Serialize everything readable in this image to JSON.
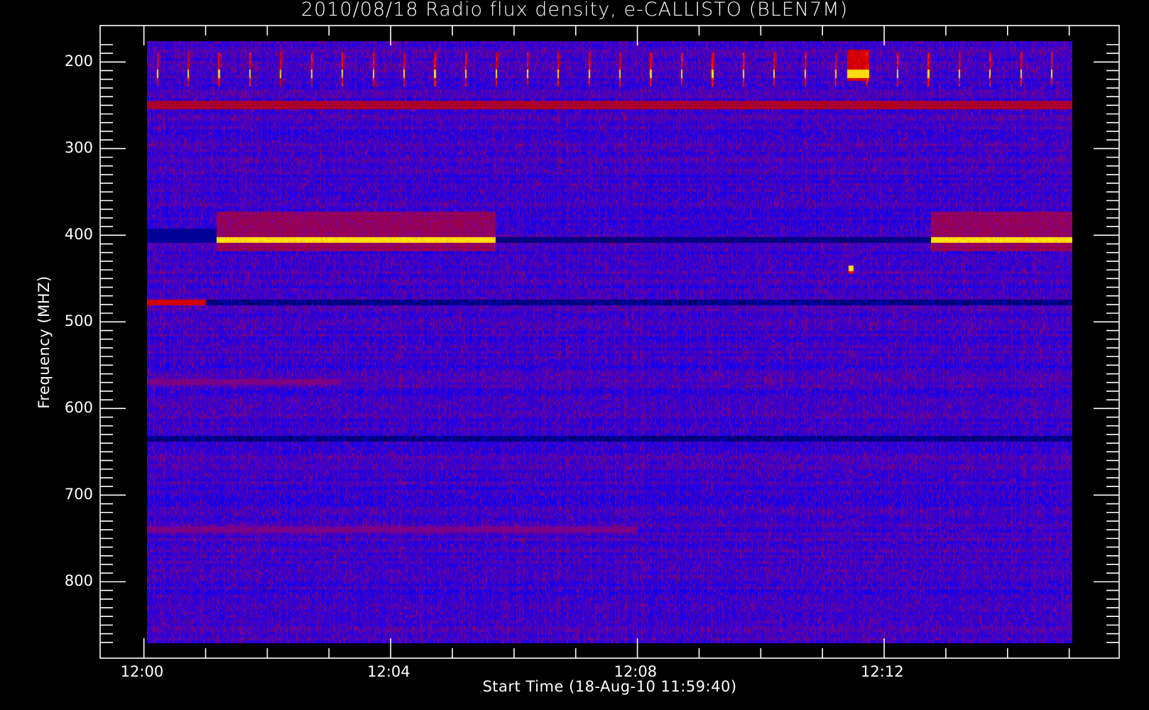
{
  "chart_data": {
    "type": "heatmap",
    "title": "2010/08/18  Radio flux density, e-CALLISTO (BLEN7M)",
    "xlabel": "Start Time (18-Aug-10 11:59:40)",
    "ylabel": "Frequency (MHZ)",
    "x_unit": "minutes after 12:00",
    "xlim": [
      0.05,
      15.05
    ],
    "ylim": [
      871,
      176
    ],
    "xticks": [
      {
        "value": 0,
        "label": "12:00"
      },
      {
        "value": 4,
        "label": "12:04"
      },
      {
        "value": 8,
        "label": "12:08"
      },
      {
        "value": 12,
        "label": "12:12"
      }
    ],
    "x_minor_step": 1,
    "yticks": [
      {
        "value": 200,
        "label": "200"
      },
      {
        "value": 300,
        "label": "300"
      },
      {
        "value": 400,
        "label": "400"
      },
      {
        "value": 500,
        "label": "500"
      },
      {
        "value": 600,
        "label": "600"
      },
      {
        "value": 700,
        "label": "700"
      },
      {
        "value": 800,
        "label": "800"
      }
    ],
    "y_minor_step": 10,
    "colormap": [
      "#000000",
      "#0000ff",
      "#7a0090",
      "#c00000",
      "#ff0000",
      "#ff8040",
      "#ffff00"
    ],
    "features": [
      {
        "name": "periodic bursts",
        "freq_range": [
          190,
          228
        ],
        "peak_freq": 213,
        "period_min": 0.5,
        "t_range": [
          0.2,
          15
        ]
      },
      {
        "name": "strong burst",
        "freq_range": [
          185,
          222
        ],
        "t_range": [
          11.4,
          11.75
        ]
      },
      {
        "name": "interference band",
        "freq": 250,
        "t_range": [
          0.05,
          15.05
        ]
      },
      {
        "name": "carrier line bright",
        "freq": 405,
        "t_range": [
          1.17,
          5.7
        ]
      },
      {
        "name": "carrier line dark",
        "freq": 405,
        "t_range": [
          5.7,
          12.75
        ]
      },
      {
        "name": "carrier line bright",
        "freq": 405,
        "t_range": [
          12.75,
          15.05
        ]
      },
      {
        "name": "spot",
        "freq": 440,
        "t_range": [
          11.42,
          11.5
        ]
      },
      {
        "name": "dark line",
        "freq": 478,
        "t_range": [
          0.05,
          15.05
        ]
      },
      {
        "name": "weak band",
        "freq": 570,
        "t_range": [
          0.05,
          3.2
        ]
      },
      {
        "name": "dark line",
        "freq": 635,
        "t_range": [
          0.05,
          15.05
        ]
      },
      {
        "name": "weak band",
        "freq": 740,
        "t_range": [
          0.05,
          8
        ]
      }
    ],
    "colors": {
      "background": "#000000",
      "axes": "#ffffff"
    }
  }
}
